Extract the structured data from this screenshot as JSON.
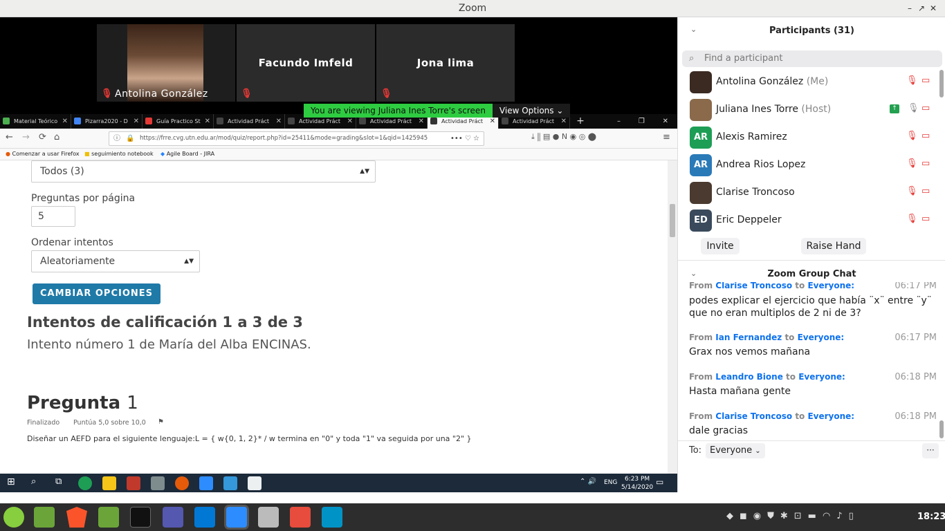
{
  "window": {
    "title": "Zoom"
  },
  "videos": [
    {
      "name": "Antolina González",
      "has_photo": true
    },
    {
      "name": "Facundo Imfeld"
    },
    {
      "name": "Jona lima"
    }
  ],
  "share_bar": {
    "viewing": "You are viewing Juliana Ines Torre's screen",
    "options": "View Options"
  },
  "browser": {
    "tabs": [
      "Material Teórico",
      "Pizarra2020 - D",
      "Guía Practico St",
      "Actividad Práct",
      "Actividad Práct",
      "Actividad Práct",
      "Actividad Práct",
      "Actividad Práct"
    ],
    "url": "https://frre.cvg.utn.edu.ar/mod/quiz/report.php?id=25411&mode=grading&slot=1&qid=1425945",
    "bookmarks": [
      "Comenzar a usar Firefox",
      "seguimiento notebook",
      "Agile Board - JIRA"
    ]
  },
  "quiz": {
    "filter_value": "Todos (3)",
    "per_page_label": "Preguntas por página",
    "per_page_value": "5",
    "order_label": "Ordenar intentos",
    "order_value": "Aleatoriamente",
    "change_button": "CAMBIAR OPCIONES",
    "heading": "Intentos de calificación 1 a 3 de 3",
    "subheading": "Intento número 1 de María del Alba ENCINAS.",
    "question_title": "Pregunta",
    "question_number": "1",
    "status": "Finalizado",
    "score": "Puntúa 5,0 sobre 10,0",
    "question_text": "Diseñar un AEFD para el siguiente lenguaje:L = { w{0, 1, 2}* / w termina en \"0\" y toda \"1\" va seguida por una \"2\" }"
  },
  "win_taskbar": {
    "time": "6:23 PM",
    "date": "5/14/2020",
    "lang": "ENG"
  },
  "participants": {
    "title": "Participants (31)",
    "search_placeholder": "Find a participant",
    "list": [
      {
        "name": "Antolina González",
        "role": "(Me)",
        "initials": "",
        "color": "#3a2a22"
      },
      {
        "name": "Juliana Ines Torre",
        "role": "(Host)",
        "initials": "",
        "color": "#8a6a4a"
      },
      {
        "name": "Alexis Ramirez",
        "role": "",
        "initials": "AR",
        "color": "#1e9e55"
      },
      {
        "name": "Andrea Rios Lopez",
        "role": "",
        "initials": "AR",
        "color": "#2a7ab8"
      },
      {
        "name": "Clarise Troncoso",
        "role": "",
        "initials": "",
        "color": "#4a3a30"
      },
      {
        "name": "Eric Deppeler",
        "role": "",
        "initials": "ED",
        "color": "#3a4a5c"
      }
    ],
    "invite": "Invite",
    "raise_hand": "Raise Hand"
  },
  "chat": {
    "title": "Zoom Group Chat",
    "partial": {
      "from": "Clarise Troncoso",
      "to": "Everyone:",
      "time": "06:17 PM"
    },
    "first_msg": "podes explicar el ejercicio que había ¨x¨ entre ¨y¨ que no eran multiplos de 2 ni de 3?",
    "messages": [
      {
        "from_label": "From",
        "from": "Ian Fernandez",
        "to_label": "to",
        "to": "Everyone:",
        "time": "06:17 PM",
        "text": "Grax nos vemos mañana"
      },
      {
        "from_label": "From",
        "from": "Leandro Bione",
        "to_label": "to",
        "to": "Everyone:",
        "time": "06:18 PM",
        "text": "Hasta mañana gente"
      },
      {
        "from_label": "From",
        "from": "Clarise Troncoso",
        "to_label": "to",
        "to": "Everyone:",
        "time": "06:18 PM",
        "text": "dale gracias"
      }
    ],
    "to_label": "To:",
    "to_value": "Everyone",
    "more": "···"
  },
  "linux_panel": {
    "time": "18:23"
  }
}
